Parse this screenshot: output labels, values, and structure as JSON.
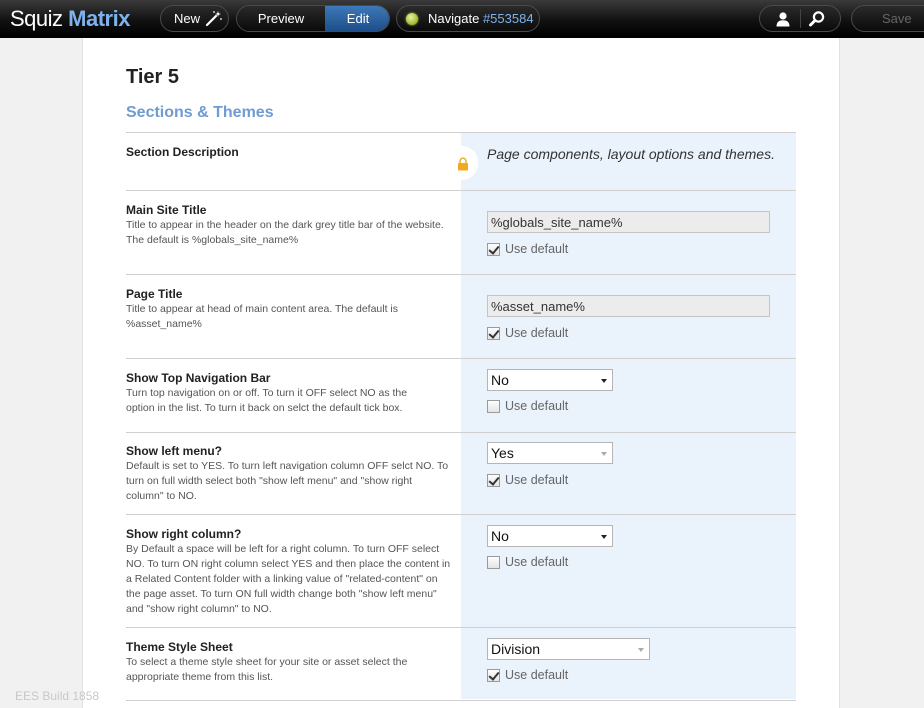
{
  "topbar": {
    "logo_part1": "Squiz",
    "logo_part2": "Matrix",
    "new_label": "New",
    "preview_label": "Preview",
    "edit_label": "Edit",
    "navigate_label": "Navigate",
    "navigate_id": "#553584",
    "save_label": "Save"
  },
  "page": {
    "title": "Tier 5",
    "section_heading": "Sections & Themes",
    "build": "EES Build 1858"
  },
  "fields": [
    {
      "label": "Section Description",
      "description": "",
      "value": "Page components, layout options and themes."
    },
    {
      "label": "Main Site Title",
      "description": "Title to appear in the header on the dark grey title bar of the website. The default is %globals_site_name%",
      "value": "%globals_site_name%",
      "use_default_label": "Use default",
      "use_default": true
    },
    {
      "label": "Page Title",
      "description": "Title to appear at head of main content area. The default is %asset_name%",
      "value": "%asset_name%",
      "use_default_label": "Use default",
      "use_default": true
    },
    {
      "label": "Show Top Navigation Bar",
      "description": "Turn top navigation on or off. To turn it OFF select NO as the option in the list. To turn it back on selct the default tick box.",
      "value": "No",
      "use_default_label": "Use default",
      "use_default": false
    },
    {
      "label": "Show left menu?",
      "description": "Default is set to YES. To turn left navigation column OFF selct NO. To turn on full width select both \"show left menu\" and \"show right column\" to NO.",
      "value": "Yes",
      "use_default_label": "Use default",
      "use_default": true
    },
    {
      "label": "Show right column?",
      "description": "By Default a space will be left for a right column. To turn OFF select NO. To turn ON right column select YES and then place the content in a Related Content folder with a linking value of \"related-content\" on the page asset. To turn ON full width change both \"show left menu\" and \"show right column\" to NO.",
      "value": "No",
      "use_default_label": "Use default",
      "use_default": false
    },
    {
      "label": "Theme Style Sheet",
      "description": "To select a theme style sheet for your site or asset select the appropriate theme from this list.",
      "value": "Division",
      "use_default_label": "Use default",
      "use_default": true
    }
  ],
  "colors": {
    "accent": "#6f9bd2",
    "right_panel": "#eaf2fc",
    "edit_active": "#2a63a3"
  }
}
